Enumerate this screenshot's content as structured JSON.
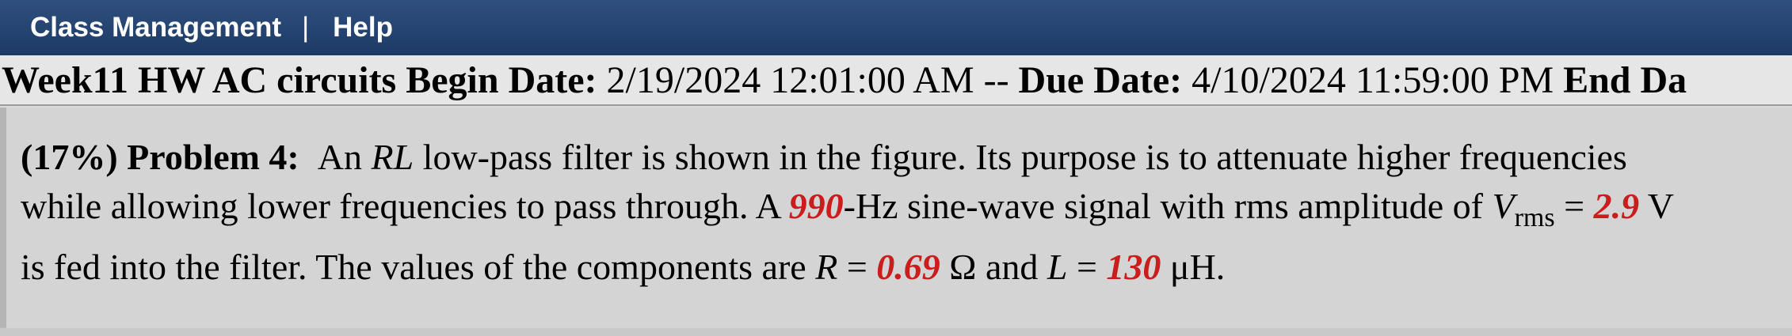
{
  "nav": {
    "class_management": "Class Management",
    "separator": "|",
    "help": "Help"
  },
  "assignment": {
    "title": "Week11 HW AC circuits",
    "begin_label": "Begin Date:",
    "begin_value": "2/19/2024 12:01:00 AM",
    "dash": "--",
    "due_label": "Due Date:",
    "due_value": "4/10/2024 11:59:00 PM",
    "end_label": "End Da"
  },
  "problem": {
    "weight": "(17%)",
    "label": "Problem 4:",
    "text_1": "An ",
    "rl": "RL",
    "text_2": " low-pass filter is shown in the figure. Its purpose is to attenuate higher frequencies while allowing lower frequencies to pass through. A ",
    "frequency": "990",
    "text_3": "-Hz sine-wave signal with rms amplitude of ",
    "v_symbol": "V",
    "v_sub": "rms",
    "eq1": " = ",
    "voltage": "2.9",
    "text_4": " V is fed into the filter. The values of the components are ",
    "r_symbol": "R",
    "eq2": " = ",
    "resistance": "0.69",
    "text_5": " Ω and ",
    "l_symbol": "L",
    "eq3": " = ",
    "inductance": "130",
    "text_6": " μH."
  },
  "colors": {
    "nav_bg": "#1d3a66",
    "highlight": "#cc1d1d"
  }
}
